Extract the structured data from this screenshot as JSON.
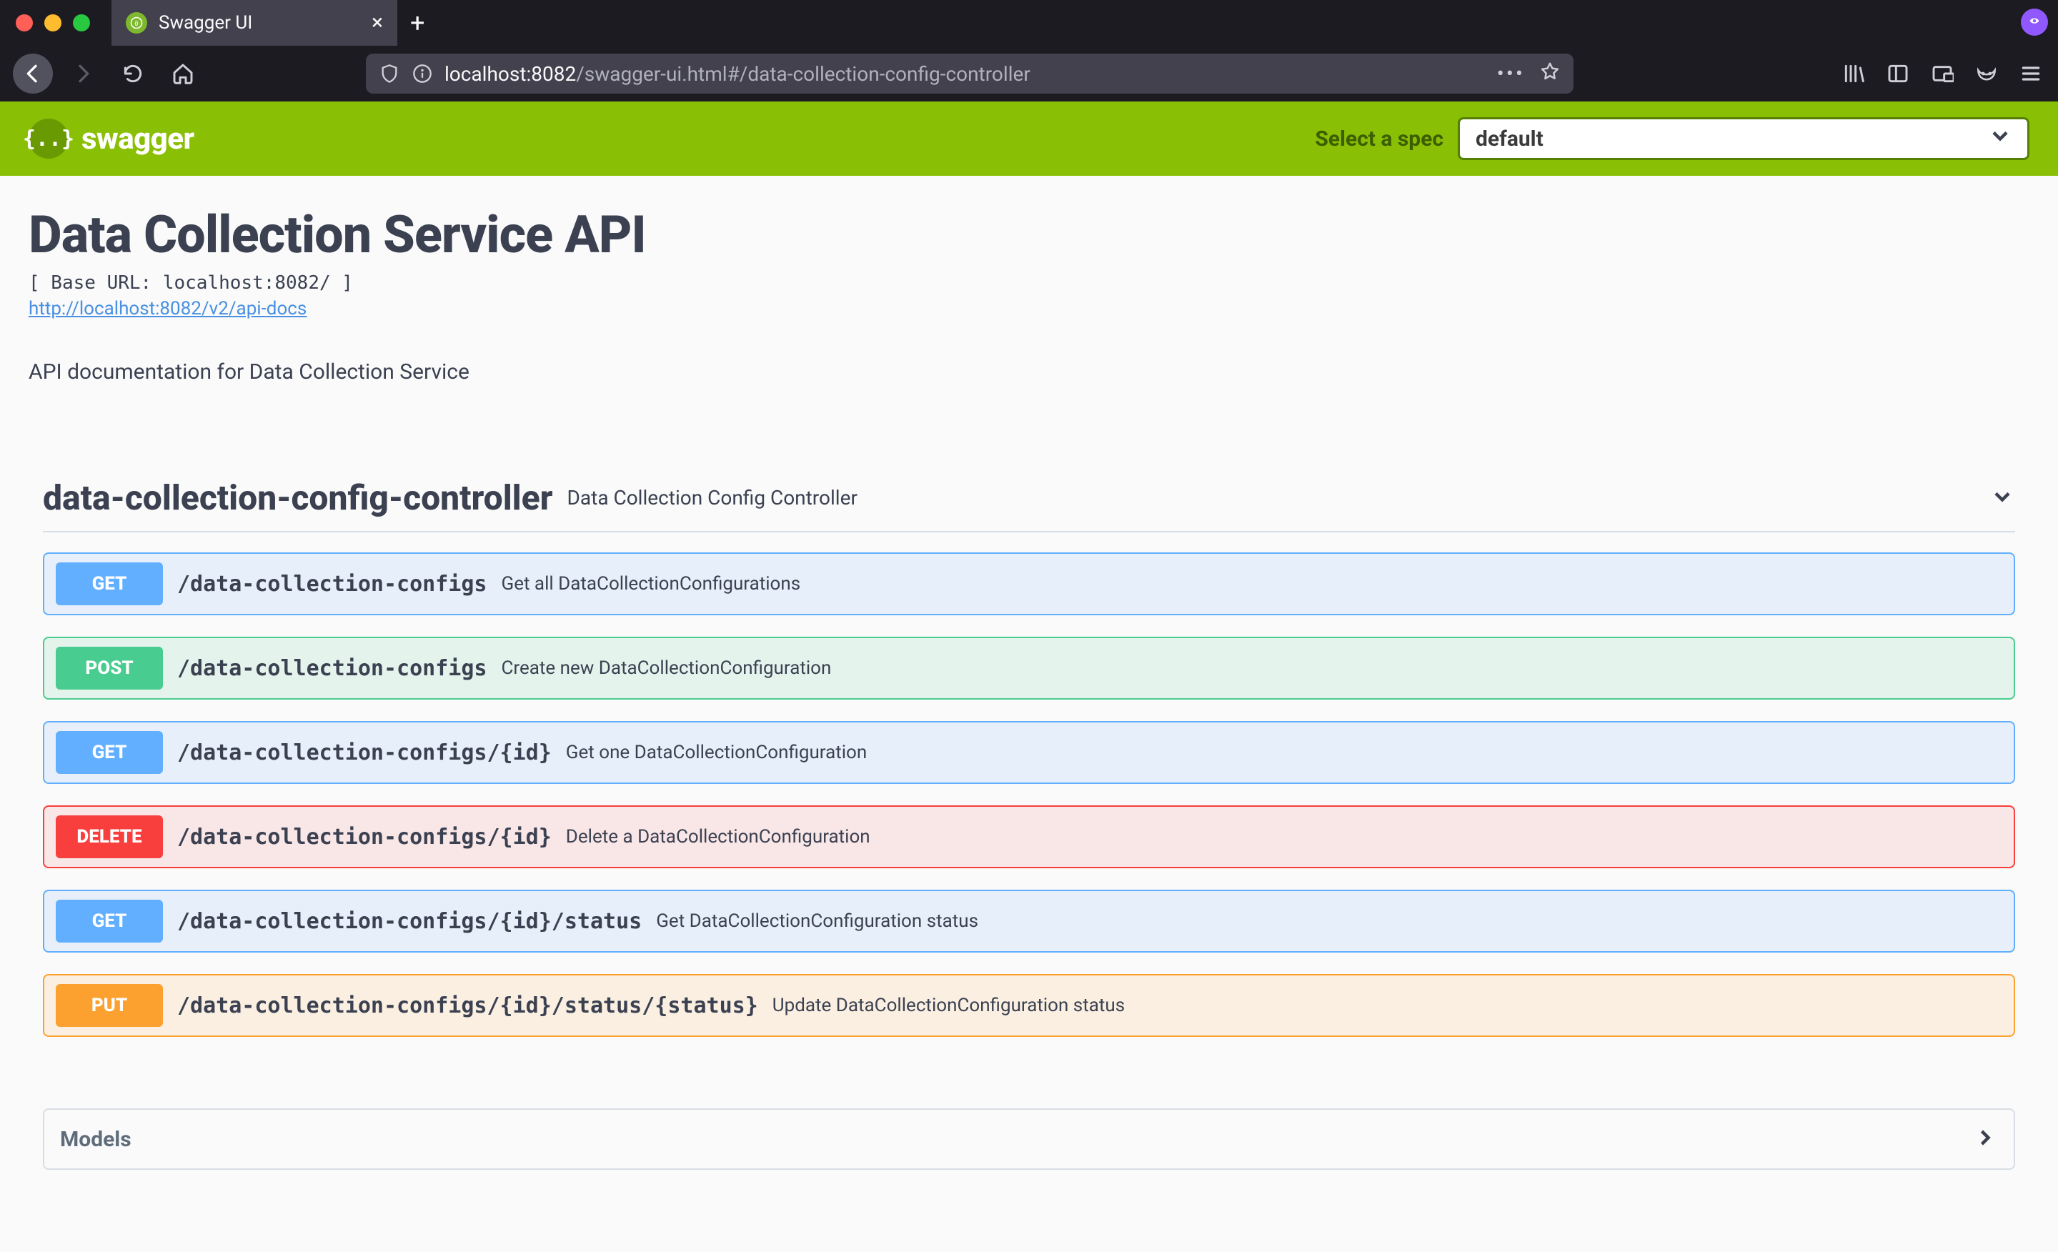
{
  "browser": {
    "tab_title": "Swagger UI",
    "url_host": "localhost:8082",
    "url_path": "/swagger-ui.html#/data-collection-config-controller"
  },
  "topbar": {
    "brand": "swagger",
    "spec_label": "Select a spec",
    "spec_value": "default"
  },
  "info": {
    "title": "Data Collection Service API",
    "base_url_line": "[ Base URL: localhost:8082/ ]",
    "docs_url": "http://localhost:8082/v2/api-docs",
    "description": "API documentation for Data Collection Service"
  },
  "tag": {
    "name": "data-collection-config-controller",
    "description": "Data Collection Config Controller"
  },
  "operations": [
    {
      "method": "GET",
      "css": "get",
      "path": "/data-collection-configs",
      "summary": "Get all DataCollectionConfigurations"
    },
    {
      "method": "POST",
      "css": "post",
      "path": "/data-collection-configs",
      "summary": "Create new DataCollectionConfiguration"
    },
    {
      "method": "GET",
      "css": "get",
      "path": "/data-collection-configs/{id}",
      "summary": "Get one DataCollectionConfiguration"
    },
    {
      "method": "DELETE",
      "css": "delete",
      "path": "/data-collection-configs/{id}",
      "summary": "Delete a DataCollectionConfiguration"
    },
    {
      "method": "GET",
      "css": "get",
      "path": "/data-collection-configs/{id}/status",
      "summary": "Get DataCollectionConfiguration status"
    },
    {
      "method": "PUT",
      "css": "put",
      "path": "/data-collection-configs/{id}/status/{status}",
      "summary": "Update DataCollectionConfiguration status"
    }
  ],
  "models": {
    "label": "Models"
  }
}
